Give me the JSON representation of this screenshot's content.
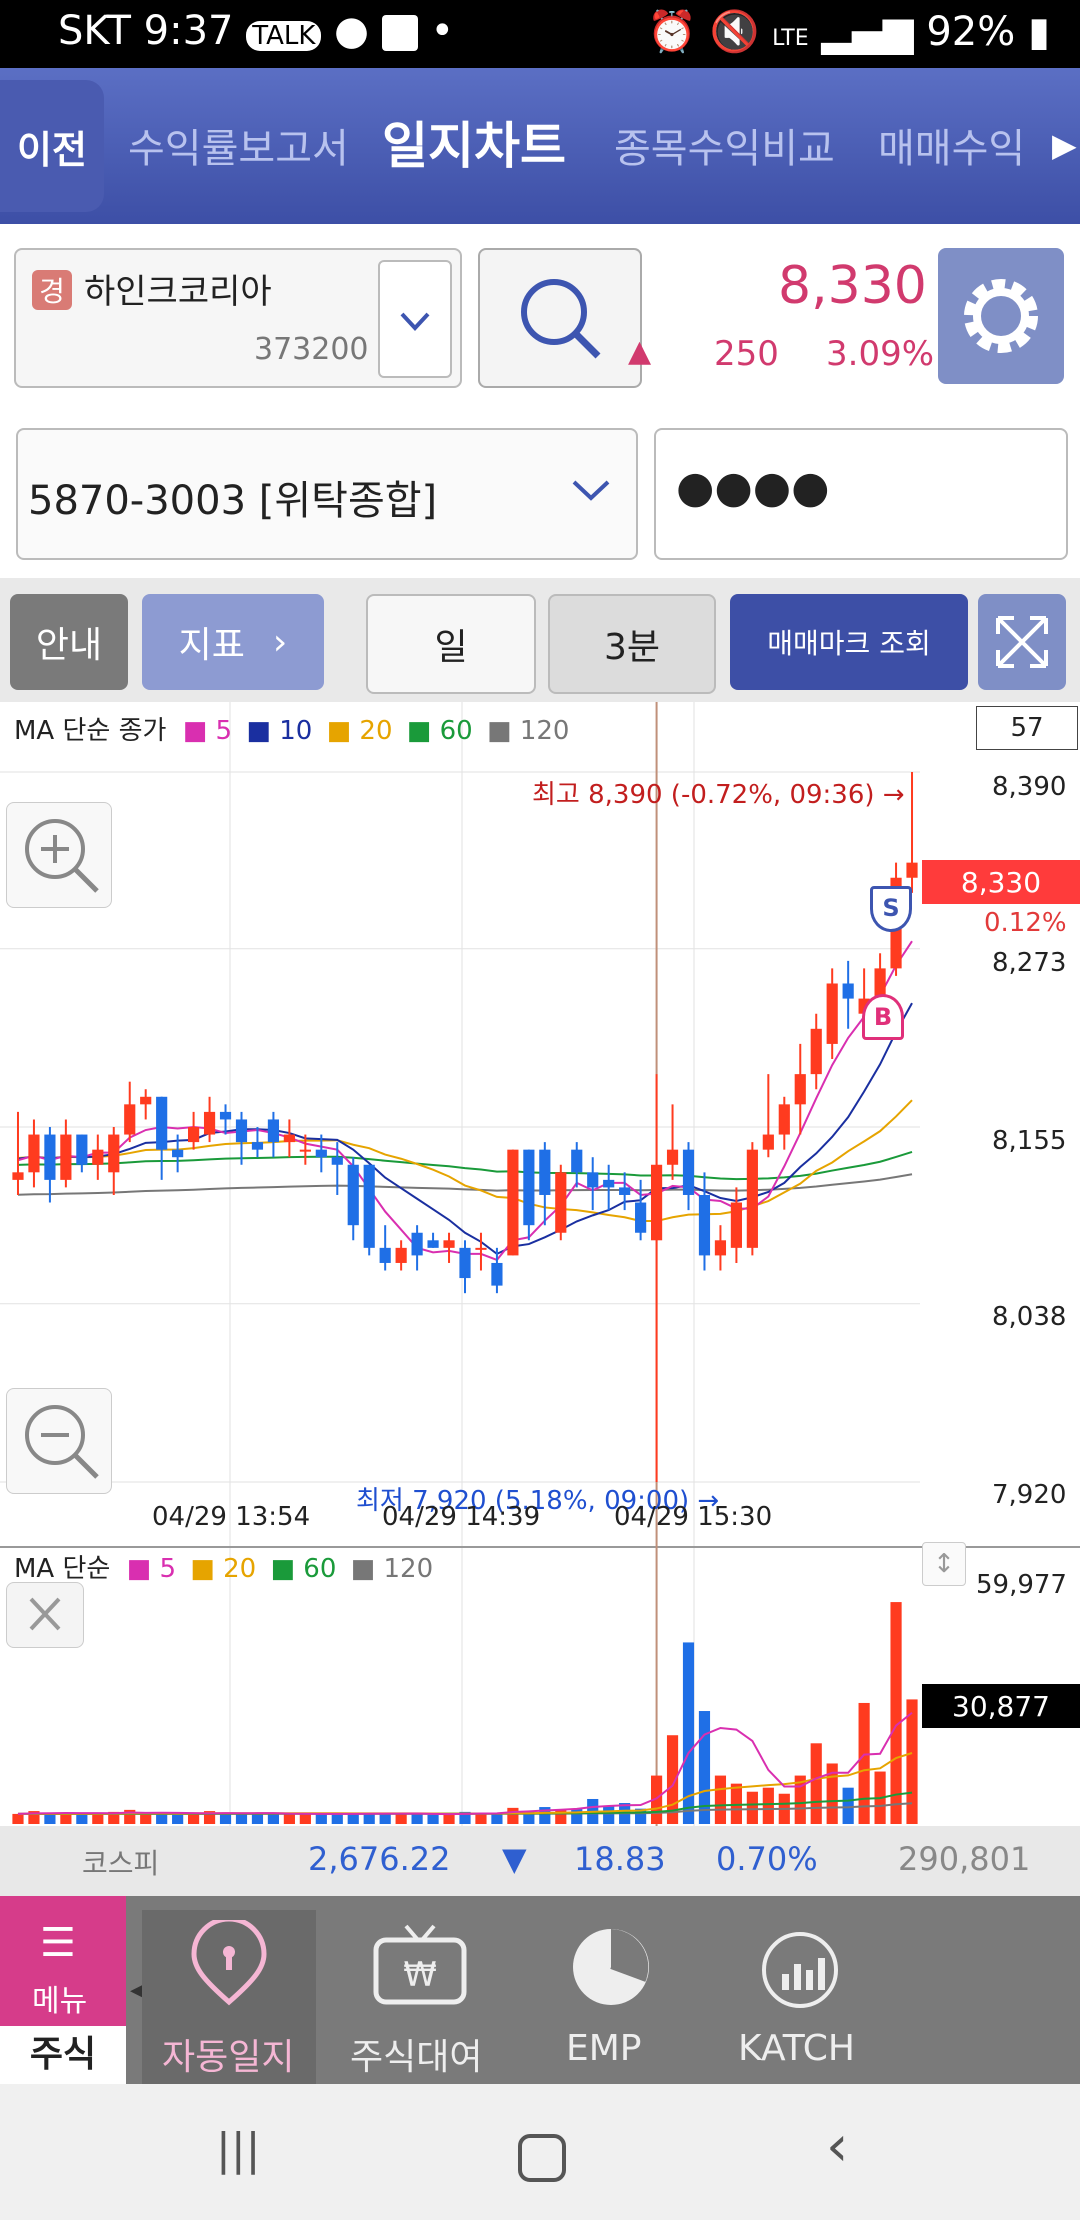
{
  "status": {
    "carrier": "SKT",
    "time": "9:37",
    "battery": "92%",
    "network": "LTE"
  },
  "nav": {
    "back": "이전",
    "tabs": [
      "수익률보고서",
      "일지차트",
      "종목수익비교",
      "매매수익"
    ],
    "active": 1
  },
  "stock": {
    "badge": "경",
    "name": "하인크코리아",
    "code": "373200",
    "price": "8,330",
    "change": "250",
    "change_pct": "3.09%",
    "direction": "▲"
  },
  "account": {
    "number": "5870-3003 [위탁종합]",
    "password": "●●●●"
  },
  "toolbar": {
    "guide": "안내",
    "indicator": "지표",
    "period": "일",
    "interval": "3분",
    "trade_mark": "매매마크 조회"
  },
  "chart": {
    "ma_label": "MA 단순 종가",
    "ma_periods": [
      "5",
      "10",
      "20",
      "60",
      "120"
    ],
    "count": "57",
    "high_note": "최고 8,390 (-0.72%, 09:36) →",
    "low_note": "최저 7,920 (5.18%, 09:00) →",
    "price_labels": [
      "8,390",
      "8,273",
      "8,155",
      "8,038",
      "7,920"
    ],
    "current": "8,330",
    "current_pct": "0.12%",
    "times": [
      "04/29 13:54",
      "04/29 14:39",
      "04/29 15:30"
    ],
    "vol_label": "MA 단순",
    "vol_periods": [
      "5",
      "20",
      "60",
      "120"
    ],
    "vol_max": "59,977",
    "vol_current": "30,877",
    "buy_mark": "B",
    "sell_mark": "S"
  },
  "chart_data": {
    "type": "candlestick",
    "colors": {
      "up": "#ff3b1f",
      "down": "#1f6fe6",
      "ma5": "#d92fb0",
      "ma10": "#1a2fa0",
      "ma20": "#e6a400",
      "ma60": "#1a9a3a",
      "ma120": "#777777"
    },
    "price_range": [
      7920,
      8390
    ],
    "candles": [
      {
        "o": 8120,
        "h": 8165,
        "l": 8110,
        "c": 8125
      },
      {
        "o": 8125,
        "h": 8160,
        "l": 8115,
        "c": 8150
      },
      {
        "o": 8150,
        "h": 8155,
        "l": 8105,
        "c": 8120
      },
      {
        "o": 8120,
        "h": 8160,
        "l": 8115,
        "c": 8150
      },
      {
        "o": 8150,
        "h": 8150,
        "l": 8125,
        "c": 8130
      },
      {
        "o": 8130,
        "h": 8150,
        "l": 8120,
        "c": 8140
      },
      {
        "o": 8125,
        "h": 8155,
        "l": 8110,
        "c": 8150
      },
      {
        "o": 8150,
        "h": 8185,
        "l": 8145,
        "c": 8170
      },
      {
        "o": 8170,
        "h": 8180,
        "l": 8160,
        "c": 8175
      },
      {
        "o": 8175,
        "h": 8175,
        "l": 8120,
        "c": 8140
      },
      {
        "o": 8140,
        "h": 8150,
        "l": 8125,
        "c": 8135
      },
      {
        "o": 8145,
        "h": 8165,
        "l": 8140,
        "c": 8155
      },
      {
        "o": 8150,
        "h": 8175,
        "l": 8145,
        "c": 8165
      },
      {
        "o": 8165,
        "h": 8170,
        "l": 8150,
        "c": 8160
      },
      {
        "o": 8160,
        "h": 8165,
        "l": 8130,
        "c": 8145
      },
      {
        "o": 8145,
        "h": 8155,
        "l": 8135,
        "c": 8140
      },
      {
        "o": 8160,
        "h": 8165,
        "l": 8135,
        "c": 8145
      },
      {
        "o": 8145,
        "h": 8160,
        "l": 8135,
        "c": 8150
      },
      {
        "o": 8140,
        "h": 8150,
        "l": 8130,
        "c": 8140
      },
      {
        "o": 8140,
        "h": 8150,
        "l": 8125,
        "c": 8135
      },
      {
        "o": 8135,
        "h": 8145,
        "l": 8110,
        "c": 8130
      },
      {
        "o": 8130,
        "h": 8135,
        "l": 8080,
        "c": 8090
      },
      {
        "o": 8130,
        "h": 8130,
        "l": 8070,
        "c": 8075
      },
      {
        "o": 8075,
        "h": 8090,
        "l": 8060,
        "c": 8065
      },
      {
        "o": 8065,
        "h": 8080,
        "l": 8060,
        "c": 8075
      },
      {
        "o": 8085,
        "h": 8090,
        "l": 8060,
        "c": 8070
      },
      {
        "o": 8080,
        "h": 8085,
        "l": 8075,
        "c": 8075
      },
      {
        "o": 8075,
        "h": 8085,
        "l": 8065,
        "c": 8080
      },
      {
        "o": 8075,
        "h": 8080,
        "l": 8045,
        "c": 8055
      },
      {
        "o": 8075,
        "h": 8085,
        "l": 8060,
        "c": 8075
      },
      {
        "o": 8065,
        "h": 8075,
        "l": 8045,
        "c": 8050
      },
      {
        "o": 8070,
        "h": 8140,
        "l": 8070,
        "c": 8140
      },
      {
        "o": 8140,
        "h": 8140,
        "l": 8080,
        "c": 8090
      },
      {
        "o": 8140,
        "h": 8145,
        "l": 8090,
        "c": 8110
      },
      {
        "o": 8085,
        "h": 8130,
        "l": 8080,
        "c": 8125
      },
      {
        "o": 8140,
        "h": 8145,
        "l": 8115,
        "c": 8125
      },
      {
        "o": 8125,
        "h": 8135,
        "l": 8100,
        "c": 8115
      },
      {
        "o": 8120,
        "h": 8130,
        "l": 8100,
        "c": 8115
      },
      {
        "o": 8115,
        "h": 8125,
        "l": 8100,
        "c": 8110
      },
      {
        "o": 8105,
        "h": 8120,
        "l": 8080,
        "c": 8085
      },
      {
        "o": 8080,
        "h": 8190,
        "l": 7920,
        "c": 8130
      },
      {
        "o": 8130,
        "h": 8170,
        "l": 8120,
        "c": 8140
      },
      {
        "o": 8140,
        "h": 8145,
        "l": 8100,
        "c": 8110
      },
      {
        "o": 8110,
        "h": 8125,
        "l": 8060,
        "c": 8070
      },
      {
        "o": 8070,
        "h": 8090,
        "l": 8060,
        "c": 8080
      },
      {
        "o": 8075,
        "h": 8115,
        "l": 8065,
        "c": 8105
      },
      {
        "o": 8075,
        "h": 8145,
        "l": 8070,
        "c": 8140
      },
      {
        "o": 8140,
        "h": 8190,
        "l": 8135,
        "c": 8150
      },
      {
        "o": 8150,
        "h": 8175,
        "l": 8140,
        "c": 8170
      },
      {
        "o": 8170,
        "h": 8210,
        "l": 8150,
        "c": 8190
      },
      {
        "o": 8190,
        "h": 8230,
        "l": 8180,
        "c": 8220
      },
      {
        "o": 8210,
        "h": 8260,
        "l": 8200,
        "c": 8250
      },
      {
        "o": 8250,
        "h": 8265,
        "l": 8220,
        "c": 8240
      },
      {
        "o": 8230,
        "h": 8260,
        "l": 8220,
        "c": 8240
      },
      {
        "o": 8235,
        "h": 8270,
        "l": 8230,
        "c": 8260
      },
      {
        "o": 8260,
        "h": 8330,
        "l": 8255,
        "c": 8320
      },
      {
        "o": 8320,
        "h": 8390,
        "l": 8310,
        "c": 8330
      }
    ],
    "volume_range": [
      0,
      59977
    ],
    "volumes": [
      2500,
      3200,
      2600,
      2800,
      2400,
      2500,
      3000,
      3500,
      2400,
      2600,
      2300,
      2700,
      3200,
      2600,
      2500,
      2400,
      2700,
      2600,
      2500,
      2400,
      2300,
      2800,
      2700,
      2600,
      2400,
      2500,
      2300,
      2400,
      3000,
      2800,
      2600,
      4000,
      3200,
      4200,
      3600,
      3800,
      6200,
      4500,
      5200,
      3800,
      12000,
      22000,
      45000,
      28000,
      12000,
      10000,
      8000,
      9000,
      7500,
      12000,
      20000,
      15000,
      9000,
      30000,
      13000,
      55000,
      30877
    ]
  },
  "kospi": {
    "label": "코스피",
    "value": "2,676.22",
    "direction": "▼",
    "change": "18.83",
    "pct": "0.70%",
    "volume": "290,801"
  },
  "bottom": {
    "menu": "메뉴",
    "stock": "주식",
    "items": [
      "자동일지",
      "주식대여",
      "EMP",
      "KATCH"
    ]
  }
}
